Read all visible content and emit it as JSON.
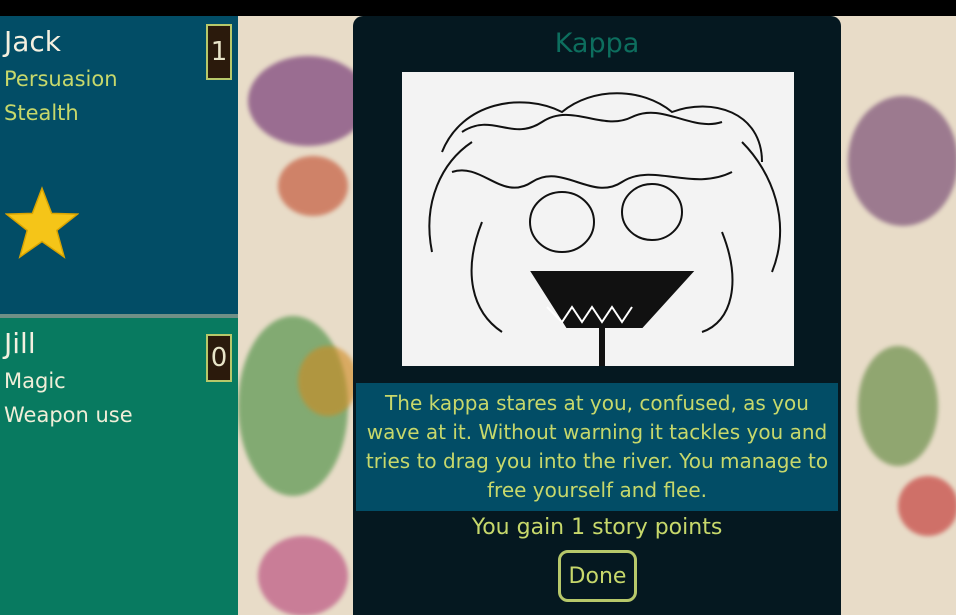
{
  "players": [
    {
      "name": "Jack",
      "skills": [
        "Persuasion",
        "Stealth"
      ],
      "score": "1",
      "has_star": true
    },
    {
      "name": "Jill",
      "skills": [
        "Magic",
        "Weapon use"
      ],
      "score": "0",
      "has_star": false
    }
  ],
  "modal": {
    "title": "Kappa",
    "image_icon": "kappa-drawing",
    "story": "The kappa stares at you, confused, as you wave at it. Without warning it tackles you and tries to drag you into the river. You manage to free yourself and flee.",
    "result": "You gain 1 story points",
    "done_label": "Done"
  },
  "colors": {
    "jack_panel": "#024d66",
    "jill_panel": "#087a60",
    "accent": "#c7d86b",
    "modal_bg": "#051820",
    "star": "#f5c518"
  }
}
